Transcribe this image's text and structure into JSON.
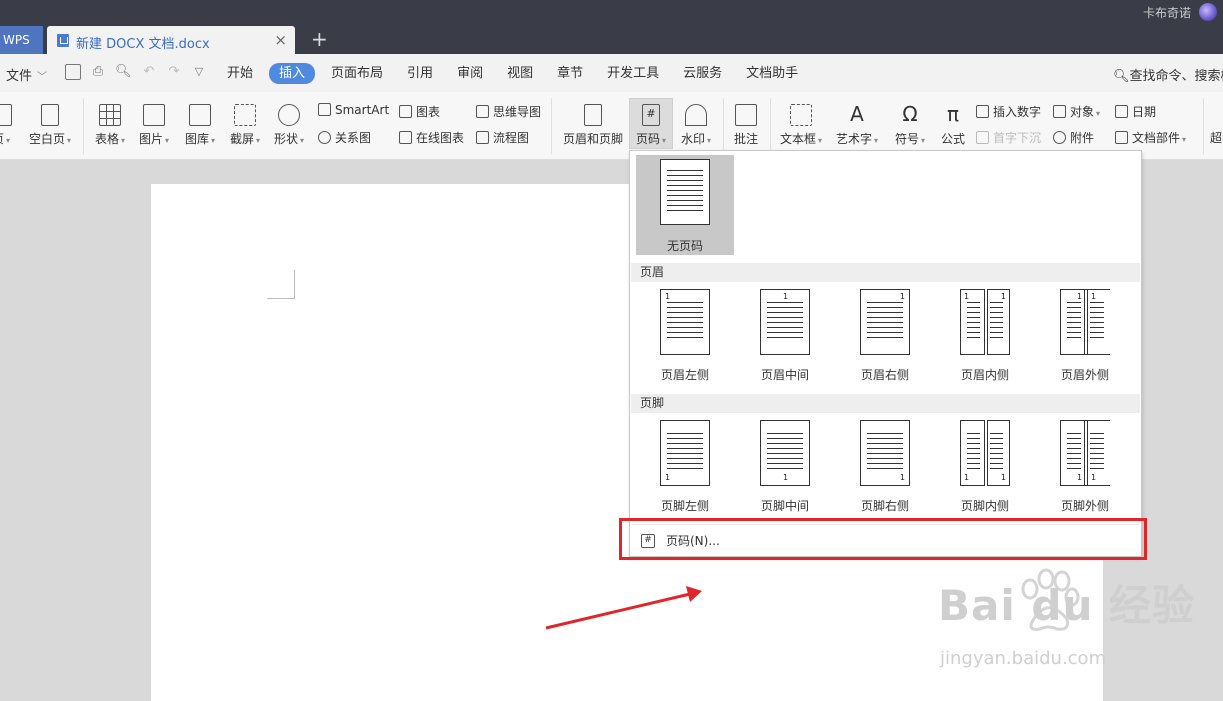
{
  "titlebar": {
    "wps_tab": "WPS",
    "doc_tab": "新建 DOCX 文档.docx",
    "close_glyph": "×",
    "new_tab_glyph": "+",
    "user": "卡布奇诺"
  },
  "menubar": {
    "file": "文件",
    "tabs": [
      "开始",
      "插入",
      "页面布局",
      "引用",
      "审阅",
      "视图",
      "章节",
      "开发工具",
      "云服务",
      "文档助手"
    ],
    "active_tab": "插入",
    "search": "查找命令、搜索模"
  },
  "ribbon": {
    "cover_page": "页",
    "blank_page": "空白页",
    "table": "表格",
    "picture": "图片",
    "gallery": "图库",
    "screenshot": "截屏",
    "shape": "形状",
    "smartart": "SmartArt",
    "chart": "图表",
    "mindmap": "思维导图",
    "relation": "关系图",
    "online_chart": "在线图表",
    "flowchart": "流程图",
    "header_footer": "页眉和页脚",
    "page_number": "页码",
    "watermark": "水印",
    "comment": "批注",
    "textbox": "文本框",
    "wordart": "艺术字",
    "symbol": "符号",
    "formula": "公式",
    "insert_number": "插入数字",
    "dropcap": "首字下沉",
    "object": "对象",
    "attachment": "附件",
    "date": "日期",
    "doc_parts": "文档部件",
    "hyperlink": "超"
  },
  "dropdown": {
    "none_label": "无页码",
    "header_section": "页眉",
    "header_options": [
      "页眉左侧",
      "页眉中间",
      "页眉右侧",
      "页眉内侧",
      "页眉外侧"
    ],
    "footer_section": "页脚",
    "footer_options": [
      "页脚左侧",
      "页脚中间",
      "页脚右侧",
      "页脚内侧",
      "页脚外侧"
    ],
    "page_number_dialog": "页码(N)...",
    "thumb_number": "1"
  },
  "watermark": {
    "brand": "Bai du 经验",
    "url": "jingyan.baidu.com"
  },
  "colors": {
    "titlebar": "#3a3d48",
    "active_tab": "#4f8ae0",
    "highlight_box": "#e0262a"
  }
}
